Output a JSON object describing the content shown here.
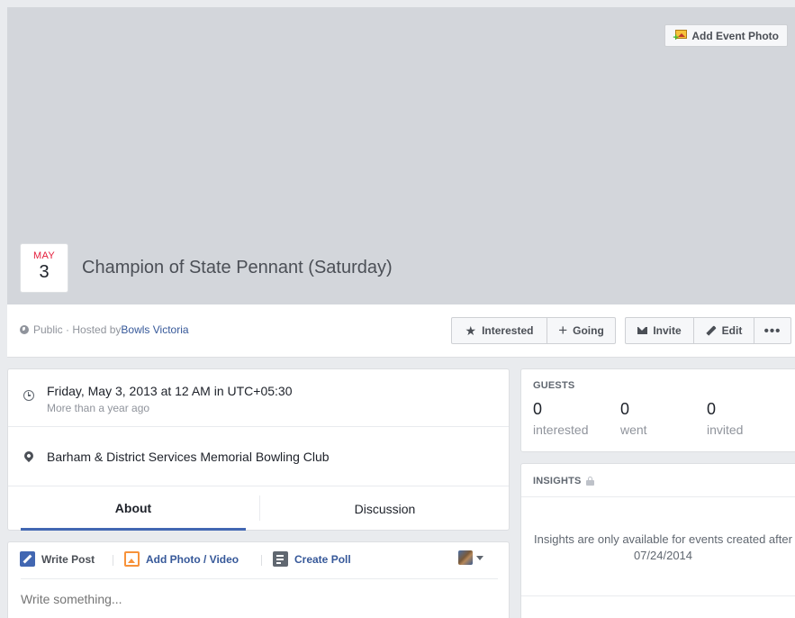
{
  "cover": {
    "add_photo_label": "Add Event Photo"
  },
  "event": {
    "month": "MAY",
    "day": "3",
    "title": "Champion of State Pennant (Saturday)"
  },
  "info": {
    "privacy_prefix": "Public · Hosted by ",
    "host": "Bowls Victoria"
  },
  "actions": {
    "interested": "Interested",
    "going": "Going",
    "invite": "Invite",
    "edit": "Edit",
    "more": "•••"
  },
  "details": {
    "date_main": "Friday, May 3, 2013 at 12 AM in UTC+05:30",
    "date_sub": "More than a year ago",
    "location": "Barham & District Services Memorial Bowling Club"
  },
  "tabs": [
    {
      "label": "About"
    },
    {
      "label": "Discussion"
    }
  ],
  "composer": {
    "write_post": "Write Post",
    "add_photo": "Add Photo / Video",
    "create_poll": "Create Poll",
    "placeholder": "Write something..."
  },
  "guests": {
    "heading": "GUESTS",
    "stats": [
      {
        "count": "0",
        "label": "interested"
      },
      {
        "count": "0",
        "label": "went"
      },
      {
        "count": "0",
        "label": "invited"
      }
    ]
  },
  "insights": {
    "heading": "INSIGHTS",
    "message": "Insights are only available for events created after 07/24/2014"
  },
  "colors": {
    "accent": "#4267b2",
    "link": "#365899",
    "month_red": "#e41c3a",
    "cover": "#d3d6db"
  }
}
